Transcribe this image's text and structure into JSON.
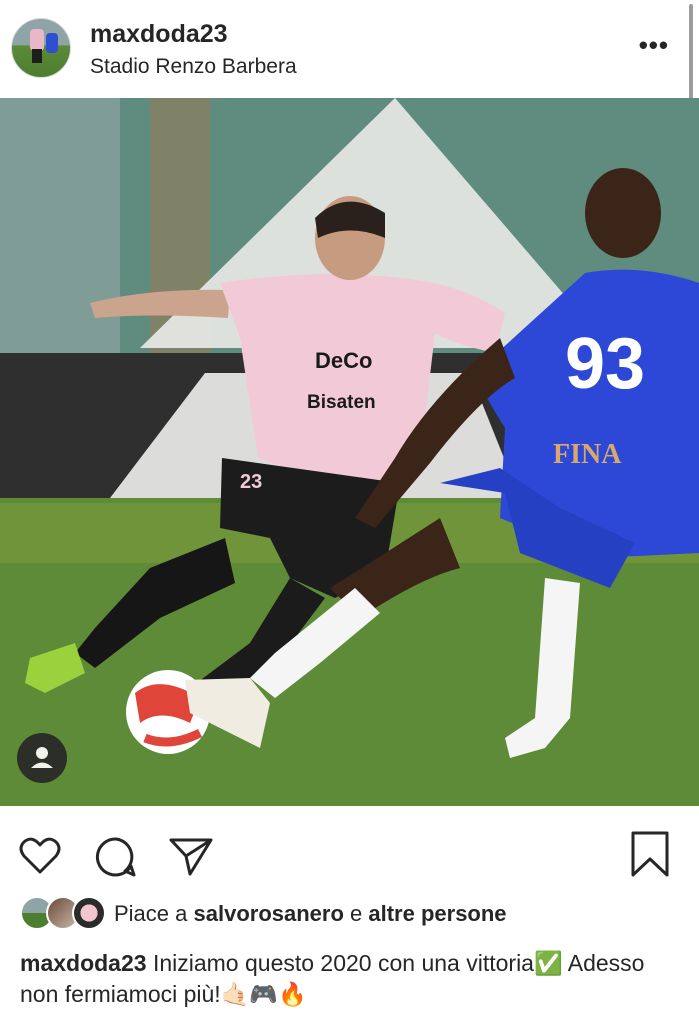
{
  "header": {
    "username": "maxdoda23",
    "location": "Stadio Renzo Barbera",
    "more_label": "•••"
  },
  "post": {
    "image_description_icon": "user-tag-icon",
    "player_left_number": "23",
    "player_right_number": "93",
    "shirt_sponsor_left_1": "DeCo",
    "shirt_sponsor_left_2": "Bisaten",
    "shirt_sponsor_right": "FINA"
  },
  "actions": {
    "like_icon": "heart-icon",
    "comment_icon": "comment-icon",
    "share_icon": "send-icon",
    "save_icon": "bookmark-icon"
  },
  "likes": {
    "prefix": "Piace a ",
    "user": "salvorosanero",
    "middle": " e ",
    "others": "altre persone"
  },
  "caption": {
    "username": "maxdoda23",
    "text": " Iniziamo questo 2020 con una vittoria✅  Adesso non fermiamoci più!🤙🏻🎮🔥"
  },
  "colors": {
    "text": "#262626",
    "divider": "#dbdbdb",
    "pink_kit": "#f2c9d6",
    "blue_kit": "#2d48d6"
  }
}
